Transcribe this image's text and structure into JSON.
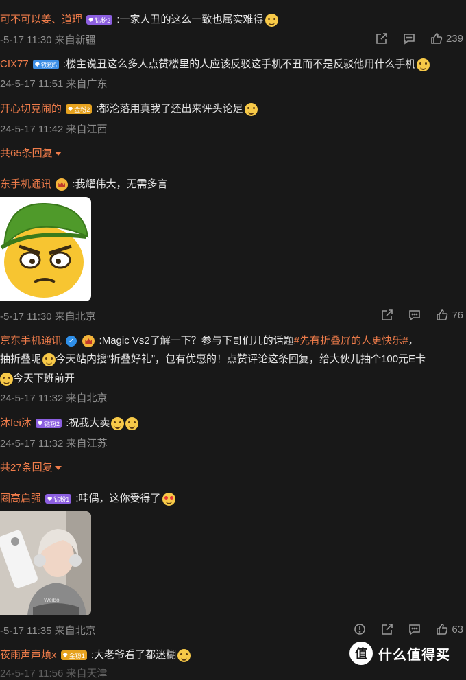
{
  "comments": [
    {
      "name": "可不可以姜、道理",
      "badge": "钻粉2",
      "text": ":一家人丑的这么一致也属实难得",
      "time": "-5-17 11:30 来自新疆",
      "likes": "239"
    },
    {
      "name": "CIX77",
      "badge": "铁粉5",
      "text": ":楼主说丑这么多人点赞楼里的人应该反驳这手机不丑而不是反驳他用什么手机",
      "time": "24-5-17 11:51 来自广东"
    },
    {
      "name": "开心切克闹的",
      "badge": "金粉2",
      "text": ":都沦落用真我了还出来评头论足",
      "time": "24-5-17 11:42 来自江西"
    },
    {
      "reply": "共65条回复"
    },
    {
      "name": "东手机通讯",
      "text": ":我耀伟大，无需多言",
      "time": "-5-17 11:30 来自北京",
      "likes": "76"
    },
    {
      "name": "京东手机通讯",
      "text_a": ":Magic Vs2了解一下？参与下哥们儿的话题",
      "tag": "#先有折叠屏的人更快乐#",
      "text_b": "，",
      "line2_a": "抽折叠呢",
      "line2_b": "今天站内搜“折叠好礼”，包有优惠的！点赞评论这条回复，给大伙儿抽个100元E卡",
      "line3": "今天下班前开",
      "time": "24-5-17 11:32 来自北京"
    },
    {
      "name": "沐fei沐",
      "badge": "钻粉2",
      "text": ":祝我大卖",
      "time": "24-5-17 11:32 来自江苏"
    },
    {
      "reply": "共27条回复"
    },
    {
      "name": "圈高启强",
      "badge": "钻粉1",
      "text": ":哇偶，这你受得了",
      "time": "-5-17 11:35 来自北京",
      "likes": "63"
    },
    {
      "name": "夜雨声声烦x",
      "badge": "金粉1",
      "text": ":大老爷看了都迷糊",
      "time": "24-5-17 11:56 来自天津"
    }
  ],
  "photo_label": "Weibo",
  "logo": {
    "mark": "值",
    "text": "什么值得买"
  },
  "icons": {
    "share": "share-icon",
    "comment": "comment-icon",
    "like": "thumbs-up-icon",
    "report": "report-icon"
  }
}
